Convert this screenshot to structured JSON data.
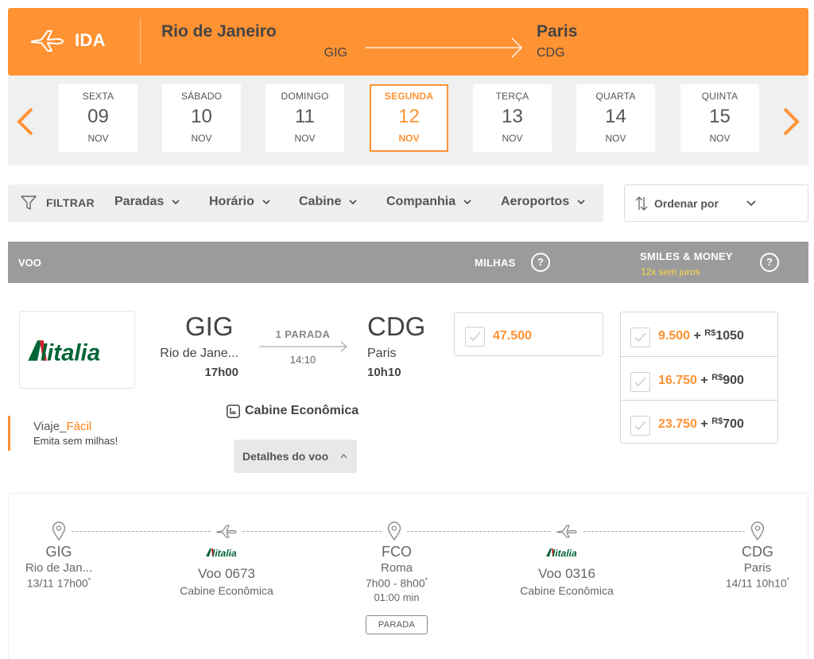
{
  "route": {
    "direction": "IDA",
    "origin_city": "Rio de Janeiro",
    "origin_code": "GIG",
    "destination_city": "Paris",
    "destination_code": "CDG"
  },
  "dates": [
    {
      "weekday": "SEXTA",
      "day": "09",
      "month": "NOV",
      "selected": false
    },
    {
      "weekday": "SÁBADO",
      "day": "10",
      "month": "NOV",
      "selected": false
    },
    {
      "weekday": "DOMINGO",
      "day": "11",
      "month": "NOV",
      "selected": false
    },
    {
      "weekday": "SEGUNDA",
      "day": "12",
      "month": "NOV",
      "selected": true
    },
    {
      "weekday": "TERÇA",
      "day": "13",
      "month": "NOV",
      "selected": false
    },
    {
      "weekday": "QUARTA",
      "day": "14",
      "month": "NOV",
      "selected": false
    },
    {
      "weekday": "QUINTA",
      "day": "15",
      "month": "NOV",
      "selected": false
    }
  ],
  "filters": {
    "label": "FILTRAR",
    "items": [
      "Paradas",
      "Horário",
      "Cabine",
      "Companhia",
      "Aeroportos"
    ],
    "sort_label": "Ordenar por"
  },
  "results_header": {
    "flight": "VOO",
    "miles": "MILHAS",
    "smiles_money": "SMILES & MONEY",
    "installments": "12x sem juros",
    "help": "?"
  },
  "flight": {
    "airline": "Alitalia",
    "origin_code": "GIG",
    "origin_city": "Rio de Jane...",
    "departure": "17h00",
    "stops": "1 PARADA",
    "duration": "14:10",
    "destination_code": "CDG",
    "destination_city": "Paris",
    "arrival": "10h10",
    "cabin": "Cabine Econômica",
    "details_button": "Detalhes do voo",
    "miles_price": "47.500",
    "smiles_money_options": [
      {
        "points": "9.500",
        "plus": "+",
        "currency": "R$",
        "amount": "1050"
      },
      {
        "points": "16.750",
        "plus": "+",
        "currency": "R$",
        "amount": "900"
      },
      {
        "points": "23.750",
        "plus": "+",
        "currency": "R$",
        "amount": "700"
      }
    ],
    "promo": {
      "prefix": "Viaje_",
      "highlight": "Fácil",
      "subtitle": "Emita sem milhas!"
    }
  },
  "itinerary": {
    "stops": [
      {
        "code": "GIG",
        "city": "Rio de Jan...",
        "time": "13/11 17h00",
        "mark": "*"
      },
      {
        "code": "FCO",
        "city": "Roma",
        "time": "7h00 - 8h00",
        "mark": "*",
        "layover": "01:00 min",
        "tag": "PARADA"
      },
      {
        "code": "CDG",
        "city": "Paris",
        "time": "14/11 10h10",
        "mark": "*"
      }
    ],
    "segments": [
      {
        "airline": "Alitalia",
        "flight": "Voo 0673",
        "cabin": "Cabine Econômica"
      },
      {
        "airline": "Alitalia",
        "flight": "Voo 0316",
        "cabin": "Cabine Econômica"
      }
    ]
  },
  "colors": {
    "accent": "#ff9233",
    "header_gray": "#9b9b9b",
    "alitalia_green": "#006437",
    "alitalia_red": "#d2232a",
    "gold": "#ffd84a"
  }
}
